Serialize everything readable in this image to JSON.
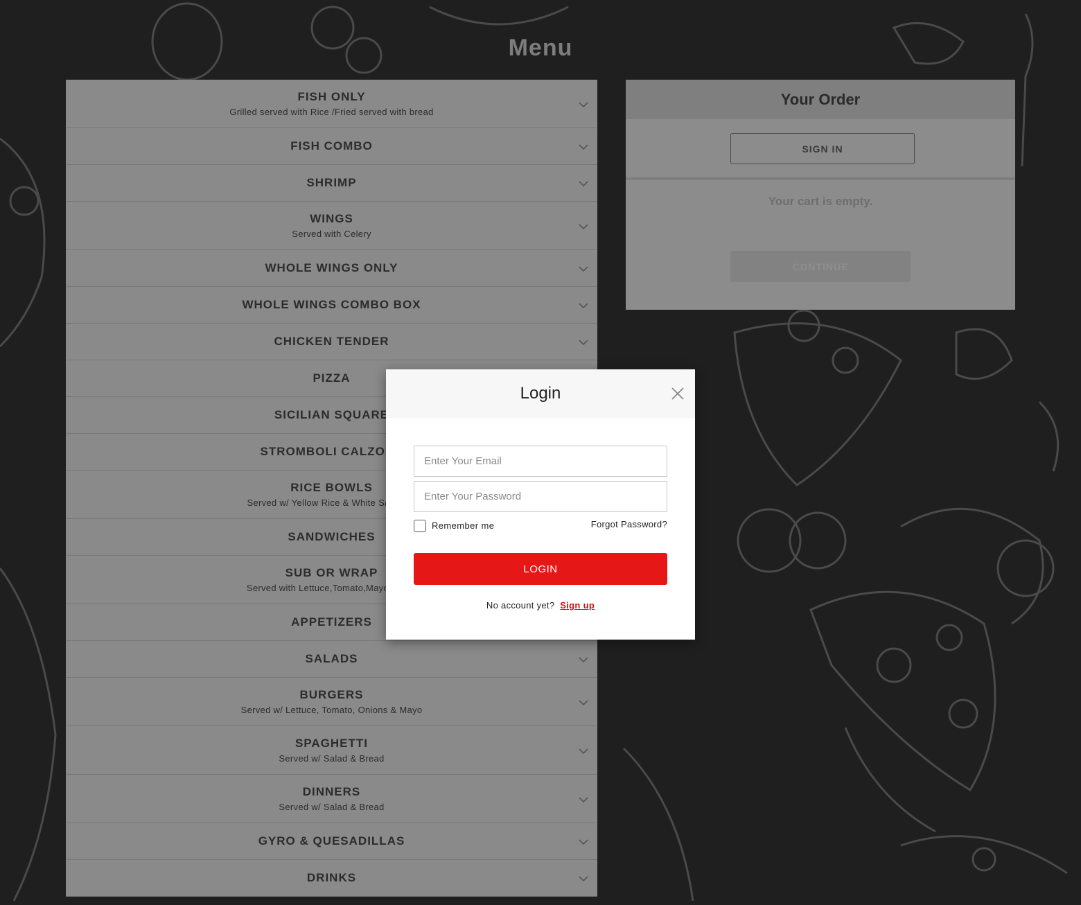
{
  "page": {
    "title": "Menu"
  },
  "menu": {
    "items": [
      {
        "title": "FISH ONLY",
        "subtitle": "Grilled served with Rice /Fried served with bread"
      },
      {
        "title": "FISH COMBO",
        "subtitle": ""
      },
      {
        "title": "SHRIMP",
        "subtitle": ""
      },
      {
        "title": "WINGS",
        "subtitle": "Served with Celery"
      },
      {
        "title": "WHOLE WINGS ONLY",
        "subtitle": ""
      },
      {
        "title": "WHOLE WINGS COMBO BOX",
        "subtitle": ""
      },
      {
        "title": "CHICKEN TENDER",
        "subtitle": ""
      },
      {
        "title": "PIZZA",
        "subtitle": ""
      },
      {
        "title": "SICILIAN SQUARE",
        "subtitle": ""
      },
      {
        "title": "STROMBOLI CALZONE",
        "subtitle": ""
      },
      {
        "title": "RICE BOWLS",
        "subtitle": "Served w/ Yellow Rice & White Sauce or"
      },
      {
        "title": "SANDWICHES",
        "subtitle": ""
      },
      {
        "title": "SUB OR WRAP",
        "subtitle": "Served with Lettuce,Tomato,Mayo,Onion"
      },
      {
        "title": "APPETIZERS",
        "subtitle": ""
      },
      {
        "title": "SALADS",
        "subtitle": ""
      },
      {
        "title": "BURGERS",
        "subtitle": "Served w/ Lettuce, Tomato, Onions & Mayo"
      },
      {
        "title": "SPAGHETTI",
        "subtitle": "Served w/ Salad & Bread"
      },
      {
        "title": "DINNERS",
        "subtitle": "Served w/ Salad & Bread"
      },
      {
        "title": "GYRO & QUESADILLAS",
        "subtitle": ""
      },
      {
        "title": "DRINKS",
        "subtitle": ""
      }
    ],
    "expand_icon": "chevron-down-icon"
  },
  "order": {
    "title": "Your Order",
    "sign_in_label": "SIGN IN",
    "empty_text": "Your cart is empty.",
    "continue_label": "CONTINUE"
  },
  "login": {
    "title": "Login",
    "close_icon": "close-icon",
    "email_placeholder": "Enter Your Email",
    "password_placeholder": "Enter Your Password",
    "remember_label": "Remember me",
    "forgot_label": "Forgot Password?",
    "login_label": "LOGIN",
    "no_account_text": "No account yet?",
    "signup_label": "Sign up"
  },
  "colors": {
    "background": "#1f1f1f",
    "login_button": "#e61717",
    "signup_link": "#d01414"
  }
}
